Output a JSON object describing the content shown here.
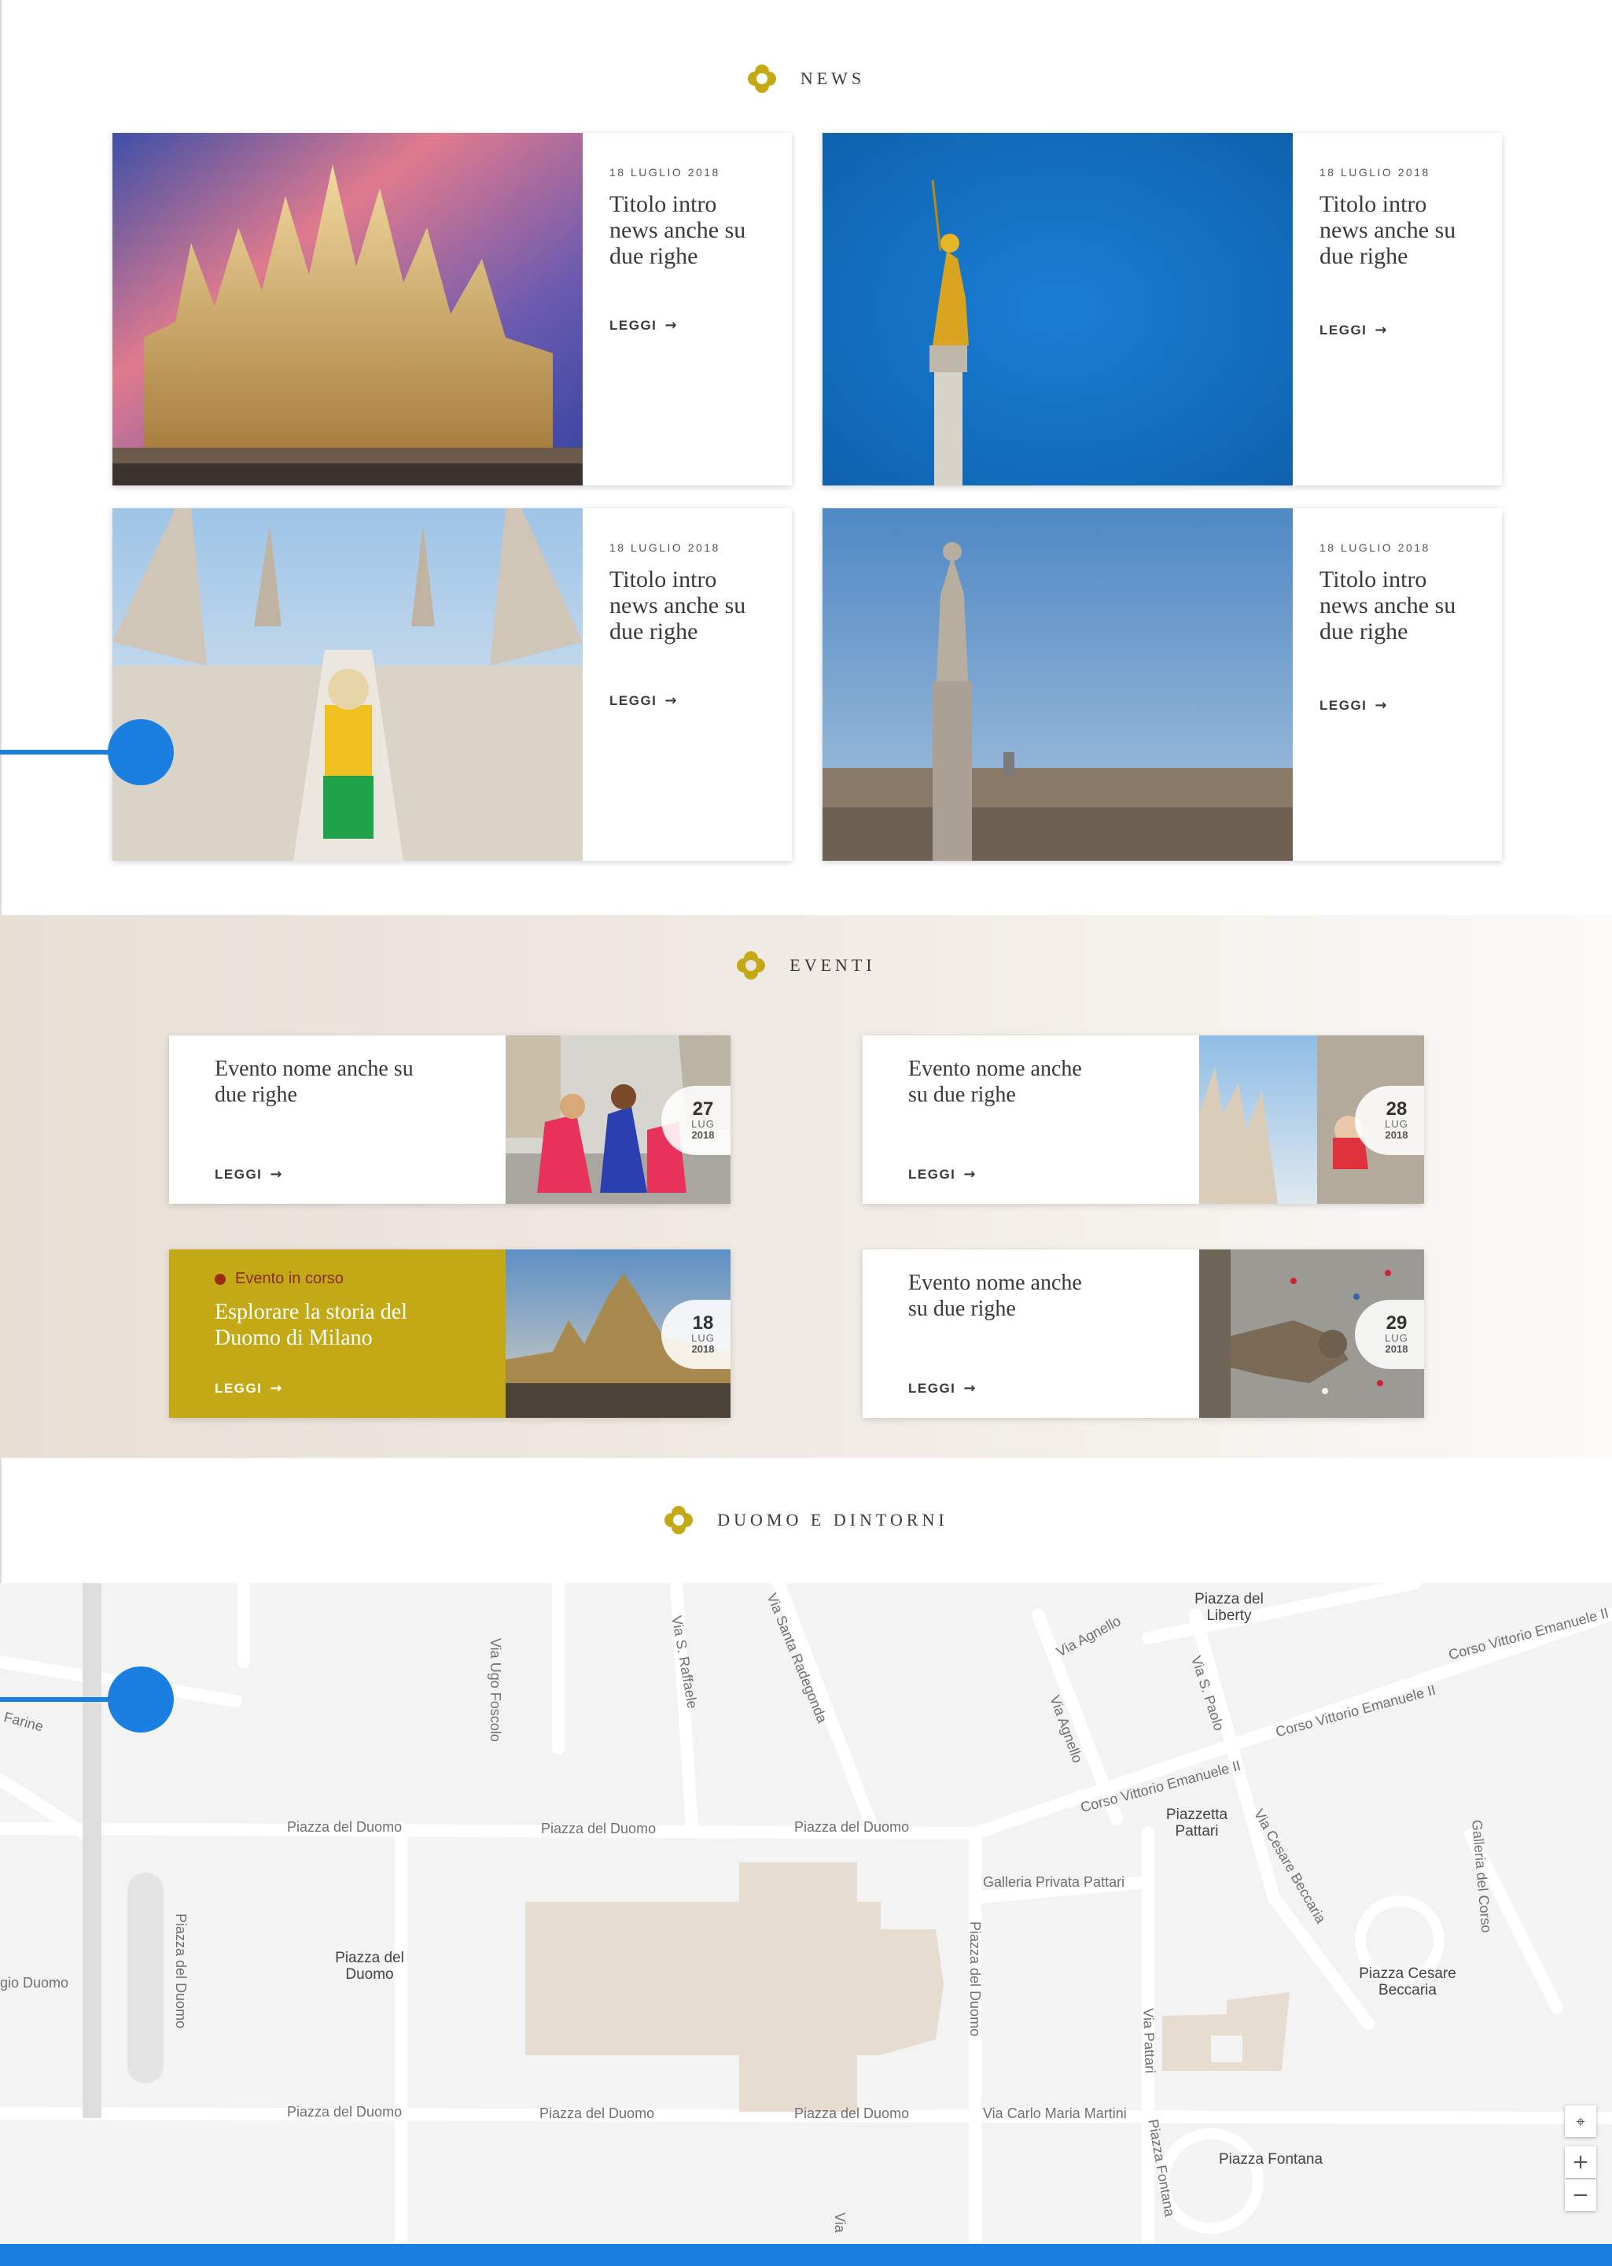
{
  "sections": {
    "news_title": "NEWS",
    "events_title": "EVENTI",
    "map_title": "DUOMO E DINTORNI"
  },
  "news": [
    {
      "date": "18 LUGLIO 2018",
      "title": "Titolo intro news anche su due righe",
      "cta": "LEGGI"
    },
    {
      "date": "18 LUGLIO 2018",
      "title": "Titolo intro news anche su due righe",
      "cta": "LEGGI"
    },
    {
      "date": "18 LUGLIO 2018",
      "title": "Titolo intro news anche su due righe",
      "cta": "LEGGI"
    },
    {
      "date": "18 LUGLIO 2018",
      "title": "Titolo intro news anche su due righe",
      "cta": "LEGGI"
    }
  ],
  "events": [
    {
      "title": "Evento nome anche su due righe",
      "cta": "LEGGI",
      "day": "27",
      "month": "LUG",
      "year": "2018"
    },
    {
      "title": "Evento nome anche su due righe",
      "cta": "LEGGI",
      "day": "28",
      "month": "LUG",
      "year": "2018"
    },
    {
      "status": "Evento in corso",
      "title": "Esplorare la storia del Duomo di Milano",
      "cta": "LEGGI",
      "day": "18",
      "month": "LUG",
      "year": "2018"
    },
    {
      "title": "Evento nome anche su due righe",
      "cta": "LEGGI",
      "day": "29",
      "month": "LUG",
      "year": "2018"
    }
  ],
  "map": {
    "streets": {
      "piazza_duomo_1": "Piazza del Duomo",
      "piazza_duomo_2": "Piazza del Duomo",
      "piazza_duomo_3": "Piazza del Duomo",
      "piazza_duomo_4": "Piazza del Duomo",
      "piazza_duomo_5": "Piazza del Duomo",
      "piazza_duomo_6": "Piazza del Duomo",
      "via_ugo_foscolo": "Via Ugo Foscolo",
      "via_s_raffaele": "Via S. Raffaele",
      "via_santa_radegonda": "Via Santa Radegonda",
      "via_agnello_1": "Via Agnello",
      "via_agnello_2": "Via Agnello",
      "via_s_paolo": "Via S. Paolo",
      "corso_ve_1": "Corso Vittorio Emanuele II",
      "corso_ve_2": "Corso Vittorio Emanuele II",
      "corso_ve_3": "Corso Vittorio Emanuele II",
      "galleria_pattari": "Galleria Privata Pattari",
      "via_pattari": "Via Pattari",
      "via_cesare_beccaria": "Via Cesare Beccaria",
      "galleria_corso": "Galleria del Corso",
      "via_carlo_maria_martini": "Via Carlo Maria Martini",
      "piazza_fontana_street": "Piazza Fontana",
      "piazza_duomo_vertical_1": "Piazza del Duomo",
      "piazza_duomo_vertical_2": "Piazza del Duomo",
      "farine": "Farine",
      "gio_duomo": "gio Duomo",
      "via_partial": "Via"
    },
    "places": {
      "piazza_liberty": "Piazza del Liberty",
      "piazzetta_pattari": "Piazzetta Pattari",
      "piazza_duomo": "Piazza del Duomo",
      "piazza_cesare_beccaria": "Piazza Cesare Beccaria",
      "piazza_fontana": "Piazza Fontana"
    },
    "controls": {
      "locate_icon": "locate-icon",
      "zoom_in": "+",
      "zoom_out": "−"
    }
  },
  "colors": {
    "accent_gold": "#c4a916",
    "connector_blue": "#1a7fe0",
    "status_red": "#8d2a14",
    "duomo_building": "#e6dccf"
  }
}
